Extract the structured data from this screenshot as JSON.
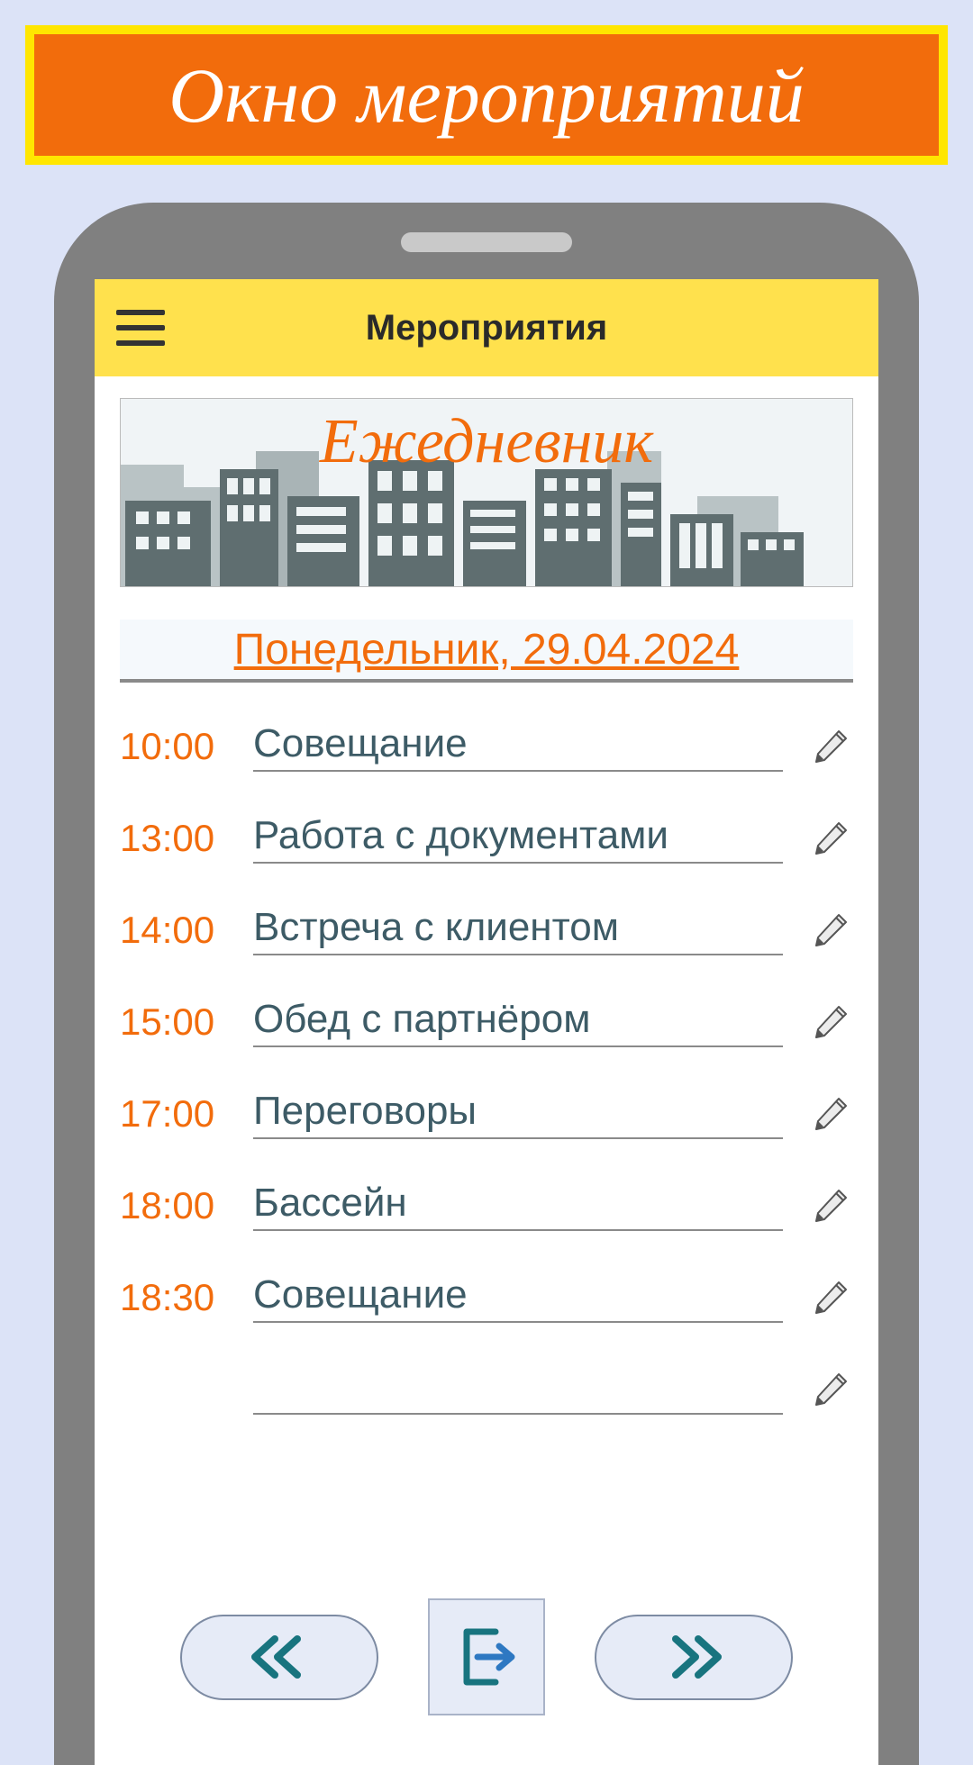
{
  "banner": {
    "title": "Окно мероприятий"
  },
  "header": {
    "title": "Мероприятия"
  },
  "hero": {
    "title": "Ежедневник"
  },
  "date": {
    "label": "Понедельник, 29.04.2024"
  },
  "events": [
    {
      "time": "10:00",
      "title": "Совещание"
    },
    {
      "time": "13:00",
      "title": "Работа с документами"
    },
    {
      "time": "14:00",
      "title": "Встреча с клиентом"
    },
    {
      "time": "15:00",
      "title": "Обед с партнёром"
    },
    {
      "time": "17:00",
      "title": "Переговоры"
    },
    {
      "time": "18:00",
      "title": "Бассейн"
    },
    {
      "time": "18:30",
      "title": "Совещание"
    },
    {
      "time": "",
      "title": ""
    }
  ],
  "icons": {
    "menu": "menu-icon",
    "pencil": "pencil-icon",
    "prev": "chevron-left-icon",
    "next": "chevron-right-icon",
    "exit": "exit-icon"
  },
  "colors": {
    "accent": "#f26c0c",
    "yellow": "#ffe14d",
    "dark_teal": "#18747f",
    "text_muted": "#3d5b66"
  }
}
